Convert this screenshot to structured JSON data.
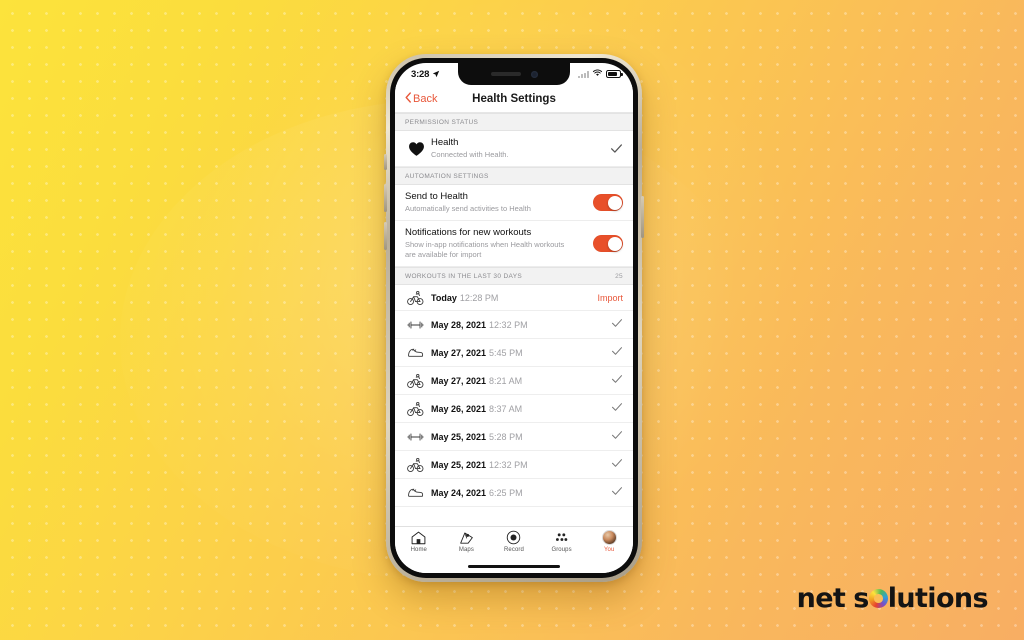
{
  "background": {
    "accent_yellow": "#FCE33C",
    "accent_orange": "#F8AE63",
    "pattern": "dot-grid"
  },
  "statusbar": {
    "time": "3:28",
    "location_icon": "location-arrow-icon",
    "signal_icon": "cellular-signal-icon",
    "wifi_icon": "wifi-icon",
    "battery_icon": "battery-icon"
  },
  "navbar": {
    "back_label": "Back",
    "title": "Health Settings",
    "accent": "#E8573A"
  },
  "sections": {
    "permission": {
      "header": "PERMISSION STATUS",
      "row": {
        "icon": "heart-icon",
        "title": "Health",
        "subtitle": "Connected with Health.",
        "status_icon": "check-icon"
      }
    },
    "automation": {
      "header": "AUTOMATION SETTINGS",
      "rows": [
        {
          "title": "Send to Health",
          "subtitle": "Automatically send activities to Health",
          "toggle_state": "on"
        },
        {
          "title": "Notifications for new workouts",
          "subtitle": "Show in-app notifications when Health workouts are available for import",
          "toggle_state": "on"
        }
      ],
      "toggle_color": "#E8502A"
    },
    "workouts": {
      "header": "WORKOUTS IN THE LAST 30 DAYS",
      "count": "25",
      "items": [
        {
          "icon": "cycling-icon",
          "date": "Today",
          "time": "12:28 PM",
          "action": "Import",
          "action_type": "link"
        },
        {
          "icon": "dumbbell-icon",
          "date": "May 28, 2021",
          "time": "12:32 PM",
          "action": "check-icon",
          "action_type": "check"
        },
        {
          "icon": "shoe-icon",
          "date": "May 27, 2021",
          "time": "5:45 PM",
          "action": "check-icon",
          "action_type": "check"
        },
        {
          "icon": "cycling-icon",
          "date": "May 27, 2021",
          "time": "8:21 AM",
          "action": "check-icon",
          "action_type": "check"
        },
        {
          "icon": "cycling-icon",
          "date": "May 26, 2021",
          "time": "8:37 AM",
          "action": "check-icon",
          "action_type": "check"
        },
        {
          "icon": "dumbbell-icon",
          "date": "May 25, 2021",
          "time": "5:28 PM",
          "action": "check-icon",
          "action_type": "check"
        },
        {
          "icon": "cycling-icon",
          "date": "May 25, 2021",
          "time": "12:32 PM",
          "action": "check-icon",
          "action_type": "check"
        },
        {
          "icon": "shoe-icon",
          "date": "May 24, 2021",
          "time": "6:25 PM",
          "action": "check-icon",
          "action_type": "check"
        }
      ]
    }
  },
  "tabbar": {
    "items": [
      {
        "label": "Home",
        "icon": "home-icon",
        "active": false
      },
      {
        "label": "Maps",
        "icon": "map-icon",
        "active": false
      },
      {
        "label": "Record",
        "icon": "record-icon",
        "active": false
      },
      {
        "label": "Groups",
        "icon": "groups-icon",
        "active": false
      },
      {
        "label": "You",
        "icon": "avatar-icon",
        "active": true
      }
    ],
    "active_color": "#E8573A"
  },
  "logo": {
    "word1": "net",
    "word2_before": "s",
    "word2_after": "lutions"
  }
}
